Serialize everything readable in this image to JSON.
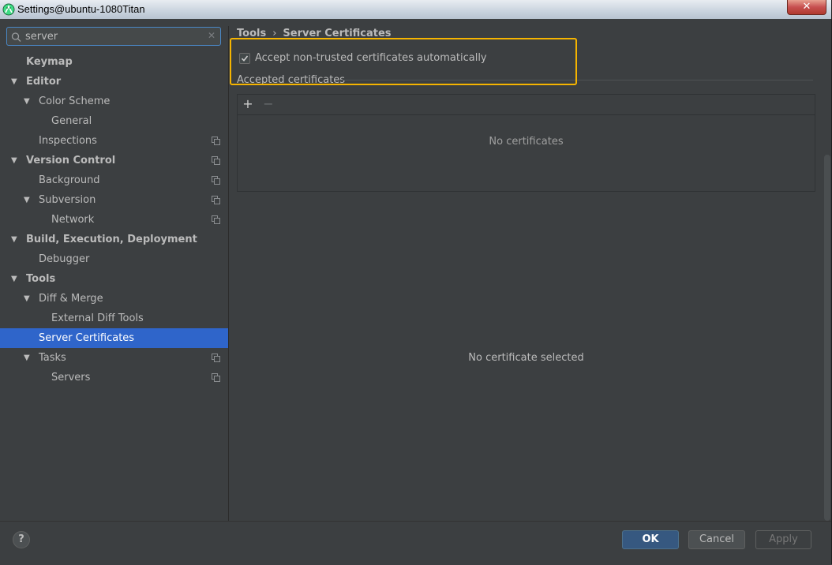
{
  "window": {
    "title": "Settings@ubuntu-1080Titan",
    "close_label": "✕"
  },
  "search": {
    "value": "server",
    "clear_label": "✕"
  },
  "tree": [
    {
      "label": "Keymap",
      "bold": true,
      "level": 0,
      "arrow": false,
      "project": false,
      "selected": false
    },
    {
      "label": "Editor",
      "bold": true,
      "level": 0,
      "arrow": true,
      "project": false,
      "selected": false
    },
    {
      "label": "Color Scheme",
      "bold": false,
      "level": 1,
      "arrow": true,
      "project": false,
      "selected": false
    },
    {
      "label": "General",
      "bold": false,
      "level": 2,
      "arrow": false,
      "project": false,
      "selected": false
    },
    {
      "label": "Inspections",
      "bold": false,
      "level": 1,
      "arrow": false,
      "project": true,
      "selected": false
    },
    {
      "label": "Version Control",
      "bold": true,
      "level": 0,
      "arrow": true,
      "project": true,
      "selected": false
    },
    {
      "label": "Background",
      "bold": false,
      "level": 1,
      "arrow": false,
      "project": true,
      "selected": false
    },
    {
      "label": "Subversion",
      "bold": false,
      "level": 1,
      "arrow": true,
      "project": true,
      "selected": false
    },
    {
      "label": "Network",
      "bold": false,
      "level": 2,
      "arrow": false,
      "project": true,
      "selected": false
    },
    {
      "label": "Build, Execution, Deployment",
      "bold": true,
      "level": 0,
      "arrow": true,
      "project": false,
      "selected": false
    },
    {
      "label": "Debugger",
      "bold": false,
      "level": 1,
      "arrow": false,
      "project": false,
      "selected": false
    },
    {
      "label": "Tools",
      "bold": true,
      "level": 0,
      "arrow": true,
      "project": false,
      "selected": false
    },
    {
      "label": "Diff & Merge",
      "bold": false,
      "level": 1,
      "arrow": true,
      "project": false,
      "selected": false
    },
    {
      "label": "External Diff Tools",
      "bold": false,
      "level": 2,
      "arrow": false,
      "project": false,
      "selected": false
    },
    {
      "label": "Server Certificates",
      "bold": false,
      "level": 1,
      "arrow": false,
      "project": false,
      "selected": true
    },
    {
      "label": "Tasks",
      "bold": false,
      "level": 1,
      "arrow": true,
      "project": true,
      "selected": false
    },
    {
      "label": "Servers",
      "bold": false,
      "level": 2,
      "arrow": false,
      "project": true,
      "selected": false
    }
  ],
  "breadcrumb": {
    "parent": "Tools",
    "separator": "›",
    "current": "Server Certificates"
  },
  "settings": {
    "accept_checkbox_label": "Accept non-trusted certificates automatically",
    "accept_checked": true,
    "accepted_group_label": "Accepted certificates",
    "add_label": "+",
    "remove_label": "−",
    "empty_list_text": "No certificates",
    "no_selection_text": "No certificate selected"
  },
  "footer": {
    "help_label": "?",
    "ok_label": "OK",
    "cancel_label": "Cancel",
    "apply_label": "Apply"
  },
  "colors": {
    "selection": "#2f65ca",
    "highlight_box": "#f5b400",
    "background": "#3c3f41"
  }
}
